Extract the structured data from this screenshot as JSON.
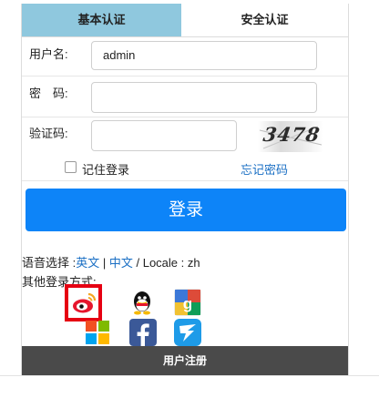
{
  "tabs": {
    "basic_auth": "基本认证",
    "security_auth": "安全认证"
  },
  "form": {
    "username": {
      "label": "用户名:",
      "value": "admin"
    },
    "password": {
      "label": "密　码:",
      "value": ""
    },
    "captcha": {
      "label": "验证码:",
      "value": "",
      "image_text": "3478"
    }
  },
  "remember": {
    "label": "记住登录",
    "checked": false
  },
  "forgot_password": "忘记密码",
  "login_button": "登录",
  "language": {
    "prefix": "语音选择 :",
    "english": "英文",
    "sep1": " | ",
    "chinese": "中文",
    "locale_text": " / Locale : zh"
  },
  "other_login": {
    "label": "其他登录方式:",
    "providers": [
      {
        "name": "weibo",
        "icon": "weibo-icon",
        "color": "#e6162d"
      },
      {
        "name": "qq",
        "icon": "qq-icon",
        "color": "#111111"
      },
      {
        "name": "google",
        "icon": "google-icon",
        "color": "#dd4b39"
      },
      {
        "name": "microsoft",
        "icon": "microsoft-icon",
        "color": "#00a4ef"
      },
      {
        "name": "facebook",
        "icon": "facebook-icon",
        "color": "#3b5998"
      },
      {
        "name": "feishu",
        "icon": "feishu-icon",
        "color": "#1e9be8"
      }
    ]
  },
  "register_bar": "用户注册",
  "colors": {
    "active_tab": "#8fc8de",
    "primary_button": "#0d84f8",
    "link": "#1a6fc4",
    "highlight": "#e60012",
    "register_bar": "#4a4a4a"
  }
}
